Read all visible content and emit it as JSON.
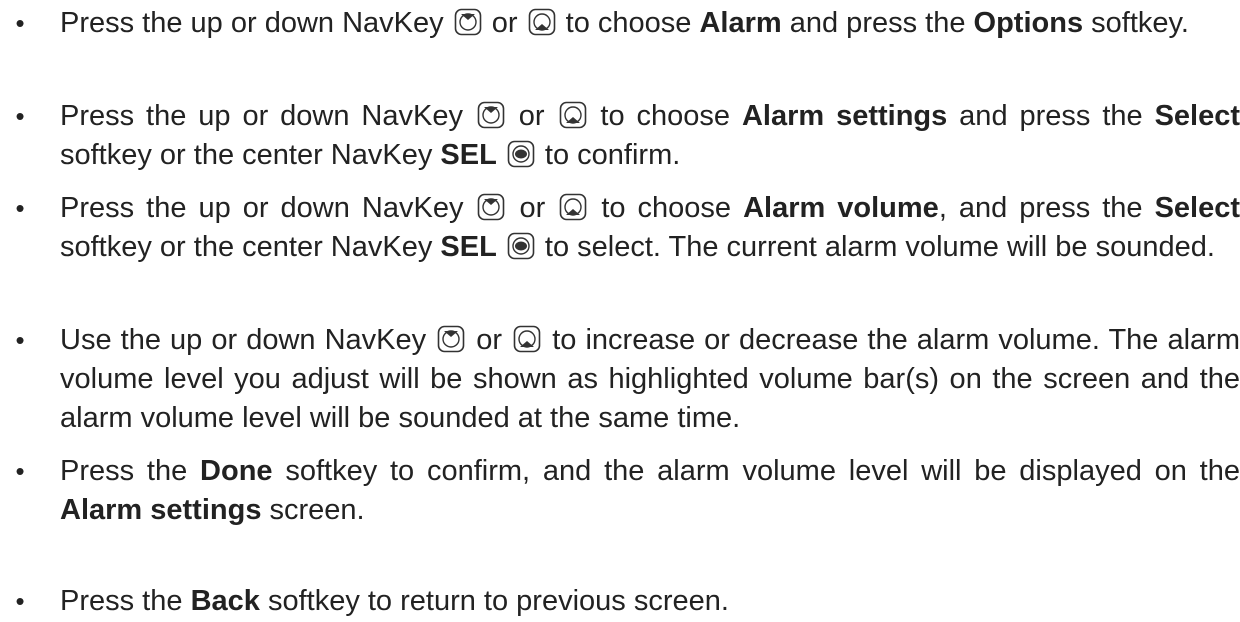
{
  "bullet_symbol": "•",
  "steps": [
    {
      "parts": [
        {
          "t": "text",
          "v": "Press the up or down NavKey "
        },
        {
          "t": "icon",
          "v": "up-navkey-icon"
        },
        {
          "t": "text",
          "v": " or "
        },
        {
          "t": "icon",
          "v": "down-navkey-icon"
        },
        {
          "t": "text",
          "v": " to choose "
        },
        {
          "t": "bold",
          "v": "Alarm"
        },
        {
          "t": "text",
          "v": " and press the "
        },
        {
          "t": "bold",
          "v": "Options"
        },
        {
          "t": "text",
          "v": " softkey."
        }
      ]
    },
    {
      "parts": [
        {
          "t": "text",
          "v": "Press the up or down NavKey "
        },
        {
          "t": "icon",
          "v": "up-navkey-icon"
        },
        {
          "t": "text",
          "v": " or "
        },
        {
          "t": "icon",
          "v": "down-navkey-icon"
        },
        {
          "t": "text",
          "v": " to choose "
        },
        {
          "t": "bold",
          "v": "Alarm settings"
        },
        {
          "t": "text",
          "v": " and press the "
        },
        {
          "t": "bold",
          "v": "Select"
        },
        {
          "t": "text",
          "v": " softkey or the center NavKey "
        },
        {
          "t": "bold",
          "v": "SEL"
        },
        {
          "t": "text",
          "v": " "
        },
        {
          "t": "icon",
          "v": "center-navkey-icon"
        },
        {
          "t": "text",
          "v": " to confirm."
        }
      ]
    },
    {
      "parts": [
        {
          "t": "text",
          "v": "Press the up or down NavKey "
        },
        {
          "t": "icon",
          "v": "up-navkey-icon"
        },
        {
          "t": "text",
          "v": " or "
        },
        {
          "t": "icon",
          "v": "down-navkey-icon"
        },
        {
          "t": "text",
          "v": " to choose "
        },
        {
          "t": "bold",
          "v": "Alarm volume"
        },
        {
          "t": "text",
          "v": ", and press the "
        },
        {
          "t": "bold",
          "v": "Select"
        },
        {
          "t": "text",
          "v": " softkey or the center NavKey "
        },
        {
          "t": "bold",
          "v": "SEL"
        },
        {
          "t": "text",
          "v": " "
        },
        {
          "t": "icon",
          "v": "center-navkey-icon"
        },
        {
          "t": "text",
          "v": " to select. The current alarm volume will be sounded."
        }
      ]
    },
    {
      "parts": [
        {
          "t": "text",
          "v": "Use the up or down NavKey "
        },
        {
          "t": "icon",
          "v": "up-navkey-icon"
        },
        {
          "t": "text",
          "v": " or "
        },
        {
          "t": "icon",
          "v": "down-navkey-icon"
        },
        {
          "t": "text",
          "v": " to increase or decrease the alarm volume. The alarm volume level you adjust will be shown as highlighted volume bar(s) on the screen and the alarm volume level will be sounded at the same time."
        }
      ]
    },
    {
      "parts": [
        {
          "t": "text",
          "v": "Press the "
        },
        {
          "t": "bold",
          "v": "Done"
        },
        {
          "t": "text",
          "v": " softkey to confirm, and the alarm volume level will be displayed on the "
        },
        {
          "t": "bold",
          "v": "Alarm settings"
        },
        {
          "t": "text",
          "v": " screen."
        }
      ]
    },
    {
      "parts": [
        {
          "t": "text",
          "v": "Press the "
        },
        {
          "t": "bold",
          "v": "Back"
        },
        {
          "t": "text",
          "v": " softkey to return to previous screen."
        }
      ]
    }
  ]
}
